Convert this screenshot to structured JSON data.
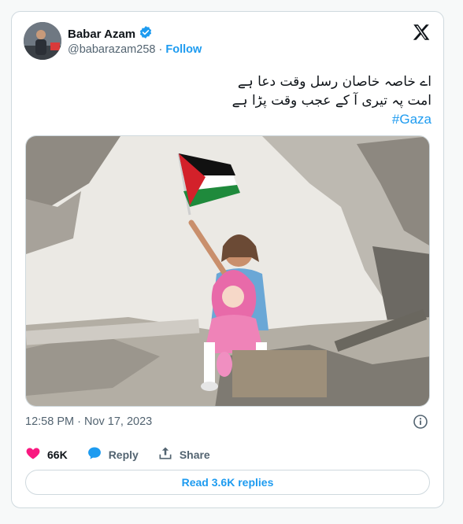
{
  "author": {
    "name": "Babar Azam",
    "handle": "@babarazam258",
    "follow_label": "Follow",
    "verified": true
  },
  "tweet": {
    "lines": [
      "اے خاصہ خاصان رسل وقت دعا ہے",
      "امت پہ تیری آ کے عجب وقت پڑا ہے"
    ],
    "hashtag": "#Gaza"
  },
  "meta": {
    "time": "12:58 PM",
    "separator": "·",
    "date": "Nov 17, 2023"
  },
  "actions": {
    "likes": "66K",
    "reply_label": "Reply",
    "share_label": "Share"
  },
  "read_replies_label": "Read 3.6K replies",
  "colors": {
    "accent": "#1d9bf0",
    "like": "#f91880",
    "muted": "#536471",
    "border": "#cfd9de"
  },
  "icons": {
    "verified": "verified-badge-icon",
    "x": "x-logo-icon",
    "info": "info-icon",
    "like": "heart-icon",
    "reply": "speech-bubble-icon",
    "share": "share-upload-icon"
  }
}
